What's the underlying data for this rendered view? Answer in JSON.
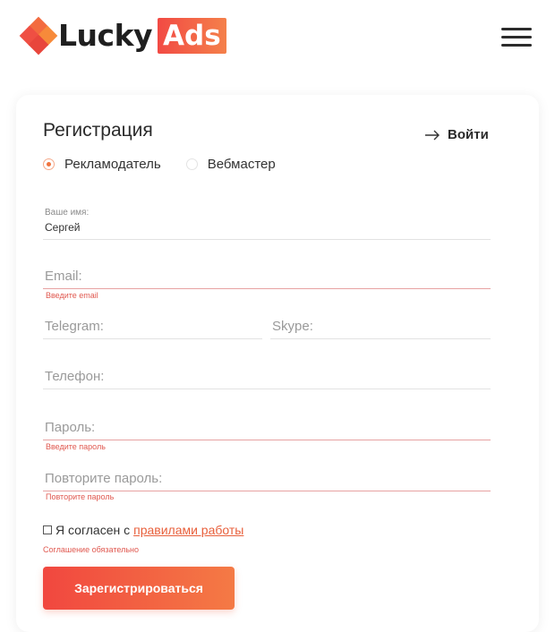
{
  "header": {
    "logo_word": "Lucky",
    "logo_badge": "Ads"
  },
  "form": {
    "title": "Регистрация",
    "login_label": "Войти",
    "roles": [
      {
        "label": "Рекламодатель",
        "checked": true
      },
      {
        "label": "Вебмастер",
        "checked": false
      }
    ],
    "name_label": "Ваше имя:",
    "name_value": "Сергей",
    "email_placeholder": "Email:",
    "email_error": "Введите email",
    "telegram_placeholder": "Telegram:",
    "skype_placeholder": "Skype:",
    "phone_placeholder": "Телефон:",
    "password_placeholder": "Пароль:",
    "password_error": "Введите пароль",
    "password_repeat_placeholder": "Повторите пароль:",
    "password_repeat_error": "Повторите пароль",
    "agree_text": "Я согласен с",
    "agree_link": "правилами работы",
    "agree_error": "Соглашение обязательно",
    "submit_label": "Зарегистрироваться"
  },
  "colors": {
    "accent": "#f1473f",
    "accent_light": "#f47a45",
    "error": "#e0584f"
  }
}
